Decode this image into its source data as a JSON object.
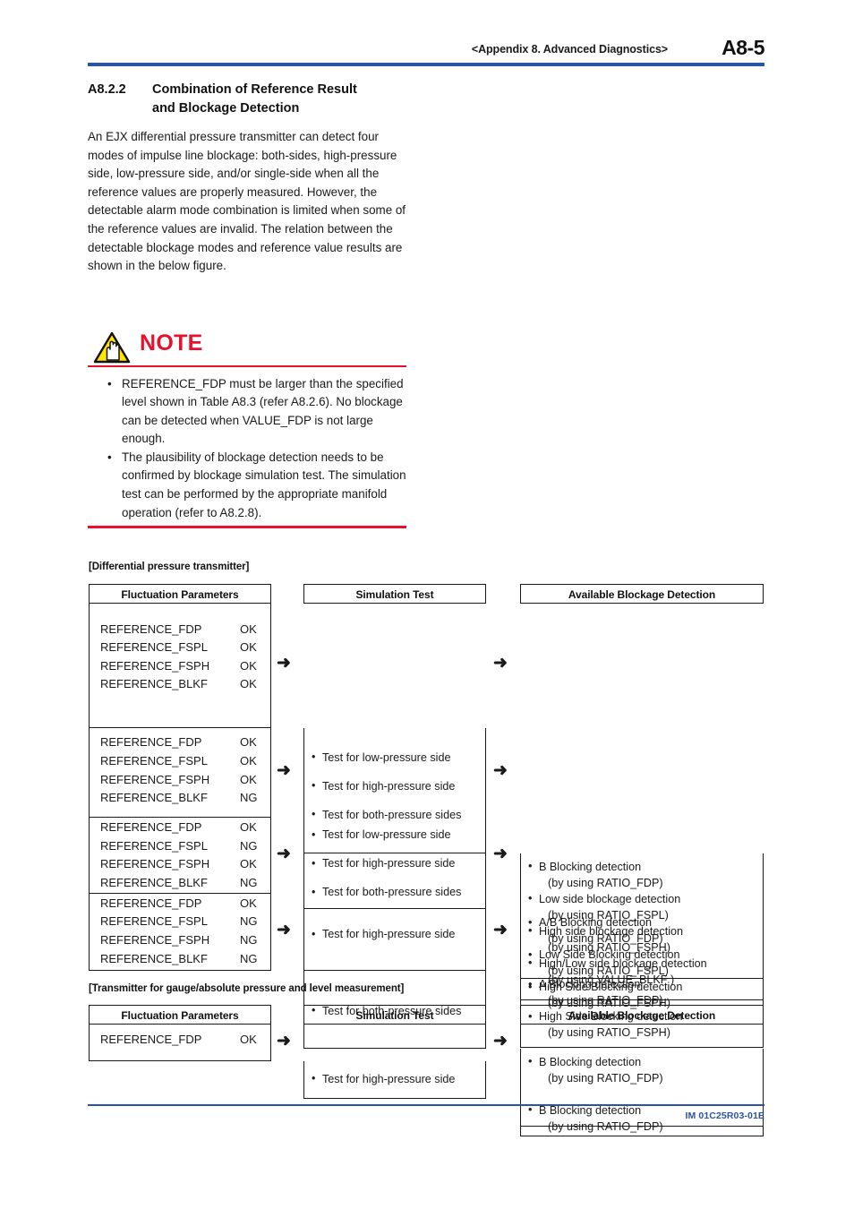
{
  "header": {
    "running_head": "<Appendix 8.  Advanced Diagnostics>",
    "page_number": "A8-5",
    "rule_color": "#2a54a5"
  },
  "section": {
    "number": "A8.2.2",
    "title": "Combination of Reference Result and Blockage Detection",
    "title_line1": "Combination of Reference Result",
    "title_line2": "and Blockage Detection"
  },
  "body": {
    "paragraph": "An EJX differential pressure transmitter can detect four modes of impulse line blockage: both-sides, high-pressure side, low-pressure side, and/or single-side when all the reference values are properly measured.  However, the detectable alarm mode combination is limited when some of the reference values are invalid. The relation between the detectable blockage modes and reference value results are shown in the below figure."
  },
  "note": {
    "title": "NOTE",
    "icon": "warning-hand-triangle-icon",
    "accent_color": "#e8112d",
    "bullet": "•",
    "items": [
      "REFERENCE_FDP must be larger than the specified level shown in Table A8.3 (refer A8.2.6). No blockage can be detected when VALUE_FDP is not large enough.",
      "The plausibility of blockage detection needs to be confirmed by blockage simulation test. The simulation test can be performed by the appropriate manifold operation (refer to A8.2.8)."
    ]
  },
  "figure1": {
    "caption": "[Differential pressure transmitter]",
    "arrow": "➜",
    "bullet": "•",
    "headers": [
      "Fluctuation Parameters",
      "Simulation Test",
      "Available Blockage Detection"
    ],
    "rows": [
      {
        "parameters": [
          {
            "name": "REFERENCE_FDP",
            "value": "OK"
          },
          {
            "name": "REFERENCE_FSPL",
            "value": "OK"
          },
          {
            "name": "REFERENCE_FSPH",
            "value": "OK"
          },
          {
            "name": "REFERENCE_BLKF",
            "value": "OK"
          }
        ],
        "tests": [
          "Test for low-pressure side",
          "Test for high-pressure side",
          "Test for both-pressure sides"
        ],
        "detections": [
          {
            "main": "B Blocking detection",
            "sub": "(by using RATIO_FDP)"
          },
          {
            "main": "Low side blockage detection",
            "sub": "(by using RATIO_FSPL)"
          },
          {
            "main": "High side blockage detection",
            "sub": "(by using RATIO_FSPH)"
          },
          {
            "main": "High/Low side blockage detection",
            "sub": "(by using VALUE_BLKF )"
          }
        ]
      },
      {
        "parameters": [
          {
            "name": "REFERENCE_FDP",
            "value": "OK"
          },
          {
            "name": "REFERENCE_FSPL",
            "value": "OK"
          },
          {
            "name": "REFERENCE_FSPH",
            "value": "OK"
          },
          {
            "name": "REFERENCE_BLKF",
            "value": "NG"
          }
        ],
        "tests": [
          "Test for low-pressure side",
          "Test for high-pressure side",
          "Test for both-pressure sides"
        ],
        "detections": [
          {
            "main": "A/B Blocking detection",
            "sub": "(by using RATIO_FDP)"
          },
          {
            "main": "Low Side Blocking detection",
            "sub": "(by using RATIO_FSPL)"
          },
          {
            "main": "High Side Blocking detection",
            "sub": "(by using RATIO_FSPH)"
          }
        ]
      },
      {
        "parameters": [
          {
            "name": "REFERENCE_FDP",
            "value": "OK"
          },
          {
            "name": "REFERENCE_FSPL",
            "value": "NG"
          },
          {
            "name": "REFERENCE_FSPH",
            "value": "OK"
          },
          {
            "name": "REFERENCE_BLKF",
            "value": "NG"
          }
        ],
        "tests": [
          "Test for high-pressure side"
        ],
        "detections": [
          {
            "main": "A Blocking detection",
            "sub": "(by using RATIO_FDP)"
          },
          {
            "main": "High Side Blocking detection",
            "sub": "(by using RATIO_FSPH)"
          }
        ]
      },
      {
        "parameters": [
          {
            "name": "REFERENCE_FDP",
            "value": "OK"
          },
          {
            "name": "REFERENCE_FSPL",
            "value": "NG"
          },
          {
            "name": "REFERENCE_FSPH",
            "value": "NG"
          },
          {
            "name": "REFERENCE_BLKF",
            "value": "NG"
          }
        ],
        "tests": [
          "Test for both-pressure sides"
        ],
        "detections": [
          {
            "main": "B Blocking detection",
            "sub": "(by using RATIO_FDP)"
          }
        ]
      }
    ]
  },
  "figure2": {
    "caption": "[Transmitter for gauge/absolute pressure and level measurement]",
    "arrow": "➜",
    "bullet": "•",
    "headers": [
      "Fluctuation Parameters",
      "Simulation Test",
      "Available Blockage Detection"
    ],
    "rows": [
      {
        "parameters": [
          {
            "name": "REFERENCE_FDP",
            "value": "OK"
          }
        ],
        "tests": [
          "Test for high-pressure side"
        ],
        "detections": [
          {
            "main": "B Blocking detection",
            "sub": "(by using RATIO_FDP)"
          }
        ]
      }
    ]
  },
  "footer": {
    "document_number": "IM 01C25R03-01E",
    "rule_color": "#2a54a5"
  }
}
